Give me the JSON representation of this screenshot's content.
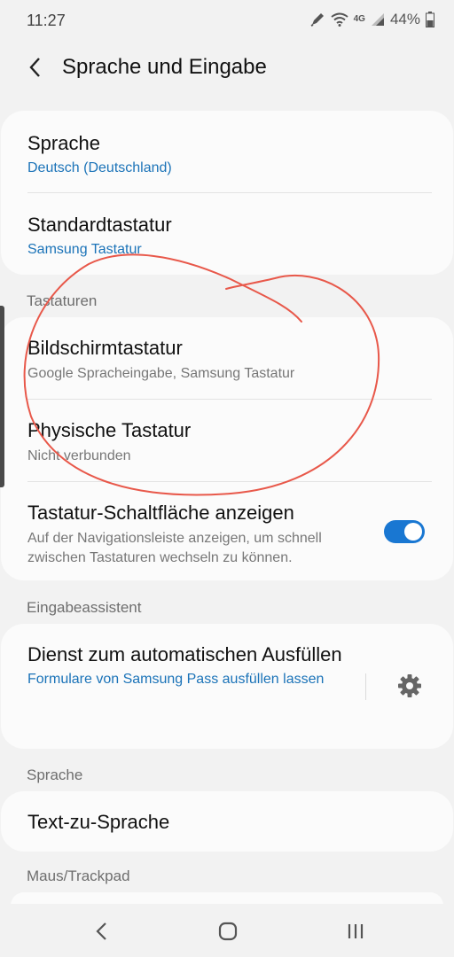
{
  "status": {
    "time": "11:27",
    "network": "4G",
    "battery": "44%"
  },
  "header": {
    "title": "Sprache und Eingabe"
  },
  "group1": {
    "items": [
      {
        "title": "Sprache",
        "subtitle": "Deutsch (Deutschland)"
      },
      {
        "title": "Standardtastatur",
        "subtitle": "Samsung Tastatur"
      }
    ]
  },
  "sections": {
    "keyboards": "Tastaturen",
    "input_assistant": "Eingabeassistent",
    "speech": "Sprache",
    "mouse": "Maus/Trackpad"
  },
  "group2": {
    "items": [
      {
        "title": "Bildschirmtastatur",
        "subtitle": "Google Spracheingabe, Samsung Tastatur"
      },
      {
        "title": "Physische Tastatur",
        "subtitle": "Nicht verbunden"
      },
      {
        "title": "Tastatur-Schaltfläche anzeigen",
        "subtitle": "Auf der Navigationsleiste anzeigen, um schnell zwischen Tastaturen wechseln zu können.",
        "toggle_on": true
      }
    ]
  },
  "group3": {
    "title": "Dienst zum automatischen Ausfüllen",
    "subtitle": "Formulare von Samsung Pass ausfüllen lassen",
    "icon": "gear-icon"
  },
  "group4": {
    "title": "Text-zu-Sprache"
  },
  "colors": {
    "accent": "#1977d2",
    "link": "#1b73b8",
    "annotation": "#e8584a"
  }
}
